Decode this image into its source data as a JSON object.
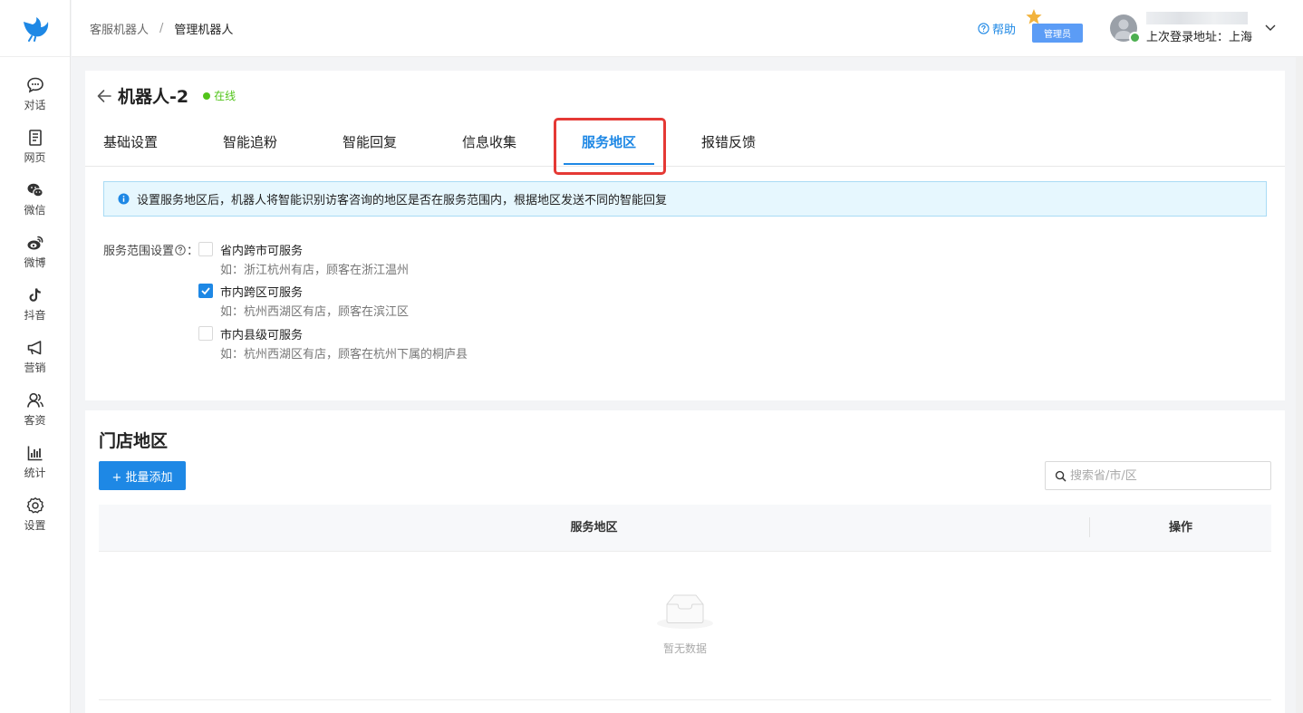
{
  "sidebar": {
    "items": [
      {
        "id": "chat",
        "label": "对话",
        "icon": "chat-bubble-icon"
      },
      {
        "id": "web",
        "label": "网页",
        "icon": "document-icon"
      },
      {
        "id": "wechat",
        "label": "微信",
        "icon": "wechat-icon"
      },
      {
        "id": "weibo",
        "label": "微博",
        "icon": "weibo-icon"
      },
      {
        "id": "douyin",
        "label": "抖音",
        "icon": "tiktok-icon"
      },
      {
        "id": "marketing",
        "label": "营销",
        "icon": "megaphone-icon"
      },
      {
        "id": "customers",
        "label": "客资",
        "icon": "users-icon"
      },
      {
        "id": "stats",
        "label": "统计",
        "icon": "bar-chart-icon"
      },
      {
        "id": "settings",
        "label": "设置",
        "icon": "gear-icon"
      }
    ]
  },
  "header": {
    "breadcrumb": [
      "客服机器人",
      "管理机器人"
    ],
    "separator": "/",
    "help_label": "帮助",
    "admin_label": "管理员",
    "last_login": "上次登录地址：上海"
  },
  "robot": {
    "name": "机器人-2",
    "status": "在线"
  },
  "tabs": [
    "基础设置",
    "智能追粉",
    "智能回复",
    "信息收集",
    "服务地区",
    "报错反馈"
  ],
  "active_tab": "服务地区",
  "notice": "设置服务地区后，机器人将智能识别访客咨询的地区是否在服务范围内，根据地区发送不同的智能回复",
  "scope": {
    "label": "服务范围设置",
    "colon": "：",
    "options": [
      {
        "title": "省内跨市可服务",
        "desc": "如：浙江杭州有店，顾客在浙江温州",
        "checked": false
      },
      {
        "title": "市内跨区可服务",
        "desc": "如：杭州西湖区有店，顾客在滨江区",
        "checked": true
      },
      {
        "title": "市内县级可服务",
        "desc": "如：杭州西湖区有店，顾客在杭州下属的桐庐县",
        "checked": false
      }
    ]
  },
  "stores": {
    "title": "门店地区",
    "add_button": "+ 批量添加",
    "search_placeholder": "搜索省/市/区",
    "columns": [
      "服务地区",
      "操作"
    ],
    "empty_text": "暂无数据"
  },
  "colors": {
    "accent": "#1e88e5",
    "online": "#52c41a",
    "highlight": "#e53935",
    "notice_bg": "#e6f7fe"
  }
}
